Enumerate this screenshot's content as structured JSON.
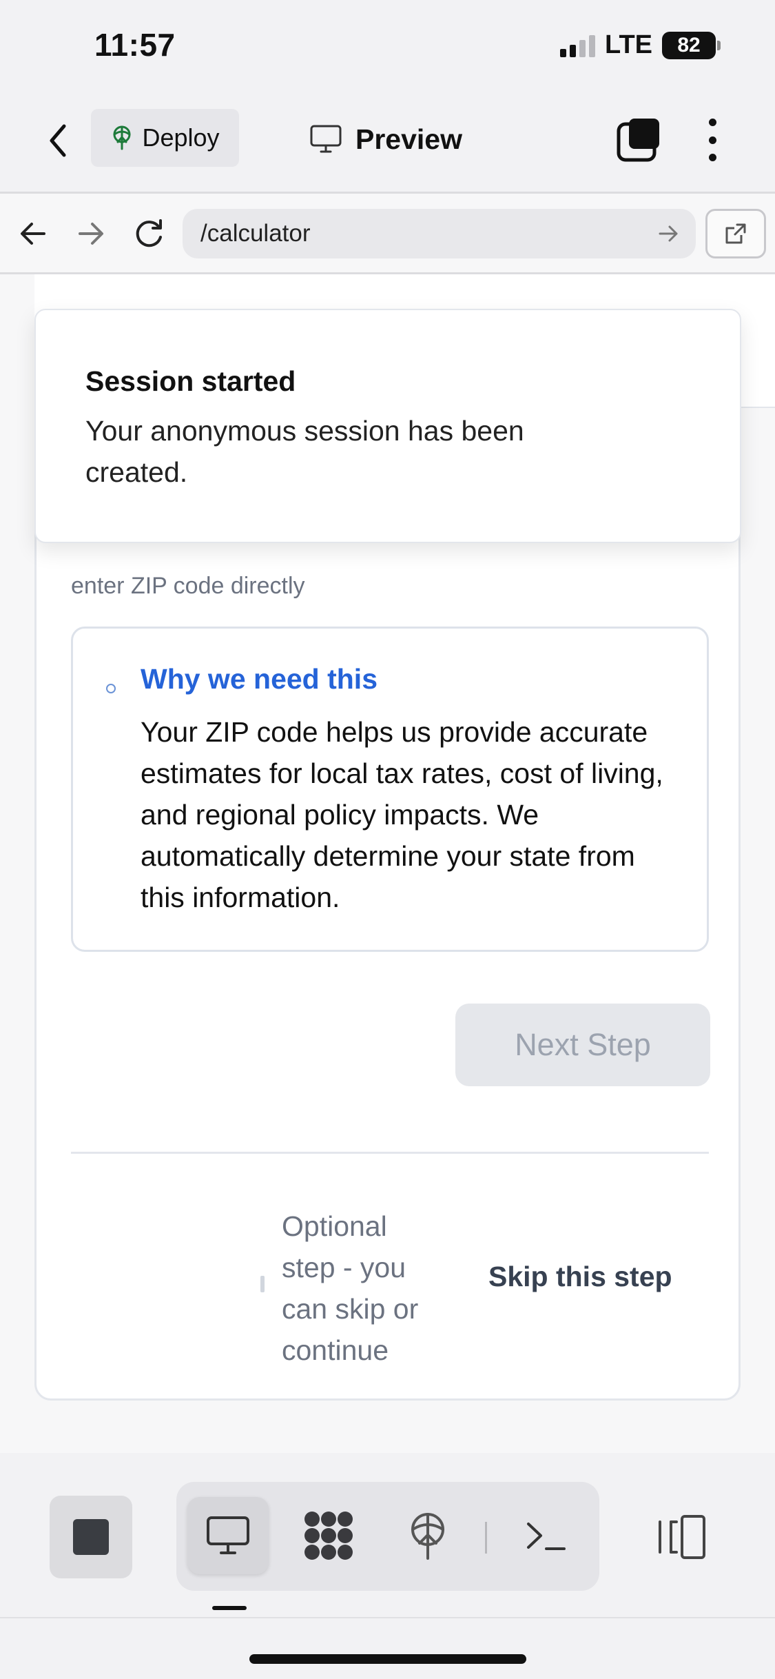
{
  "status_bar": {
    "time": "11:57",
    "network": "LTE",
    "battery": "82"
  },
  "app_bar": {
    "deploy_label": "Deploy",
    "preview_label": "Preview"
  },
  "browser": {
    "url": "/calculator"
  },
  "toast": {
    "title": "Session started",
    "body": "Your anonymous session has been created."
  },
  "form": {
    "zip_hint": "enter ZIP code directly",
    "info_title": "Why we need this",
    "info_body": "Your ZIP code helps us provide accurate estimates for local tax rates, cost of living, and regional policy impacts. We automatically determine your state from this information.",
    "next_button": "Next Step",
    "optional_text": "Optional step - you can skip or continue",
    "skip_button": "Skip this step"
  },
  "colors": {
    "accent": "#2563d8",
    "muted": "#6b7280",
    "disabled_bg": "#e5e7eb"
  },
  "toolbar": {
    "icons": [
      "stop-icon",
      "desktop-icon",
      "apps-icon",
      "deploy-icon",
      "terminal-icon",
      "panel-icon"
    ]
  }
}
